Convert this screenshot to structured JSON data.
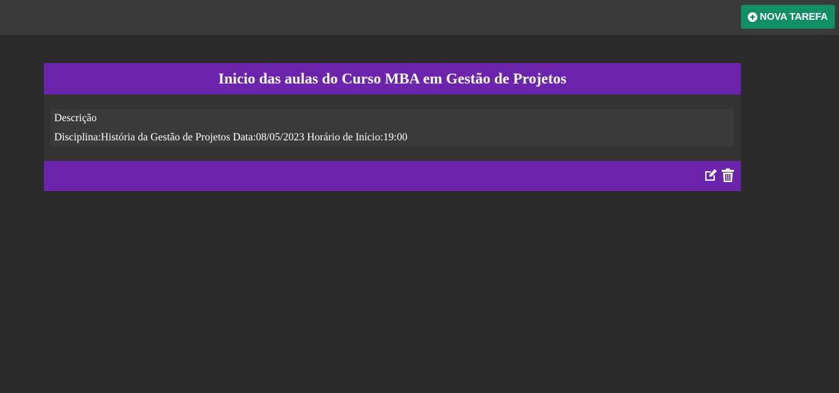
{
  "topbar": {
    "new_task_label": "NOVA TAREFA",
    "new_task_icon": "plus-circle-icon",
    "button_color": "#0f8f63"
  },
  "task": {
    "title": "Inicio das aulas do Curso MBA em Gestão de Projetos",
    "description_label": "Descrição",
    "details": "Disciplina:História da Gestão de Projetos Data:08/05/2023 Horário de Início:19:00",
    "accent_color": "#6b24ab",
    "actions": {
      "edit_icon": "edit-icon",
      "delete_icon": "trash-icon"
    }
  }
}
